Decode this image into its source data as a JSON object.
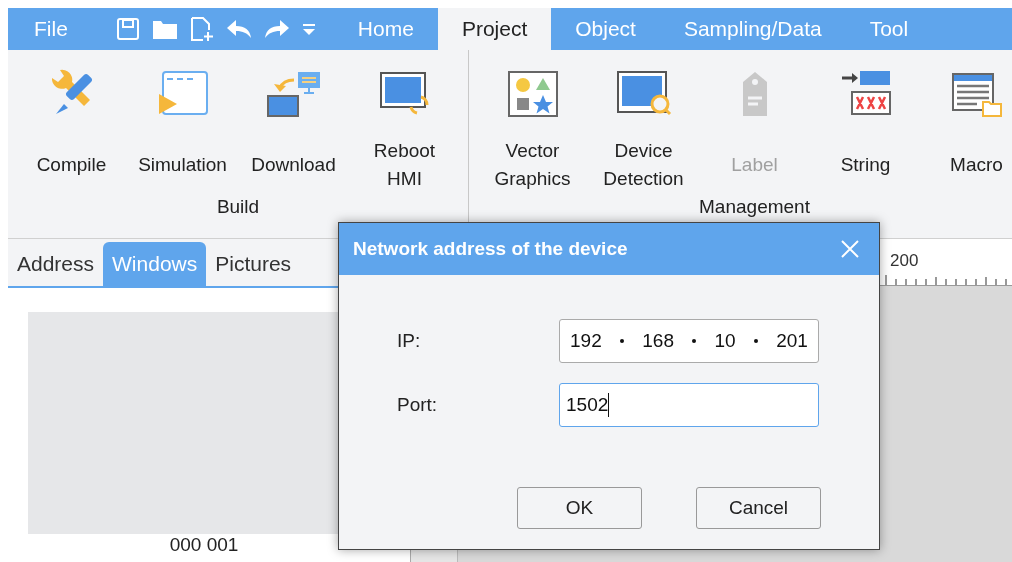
{
  "menu_bar": {
    "file": "File",
    "tabs": [
      {
        "label": "Home",
        "selected": false
      },
      {
        "label": "Project",
        "selected": true
      },
      {
        "label": "Object",
        "selected": false
      },
      {
        "label": "Sampling/Data",
        "selected": false
      },
      {
        "label": "Tool",
        "selected": false
      }
    ]
  },
  "ribbon": {
    "groups": [
      {
        "title": "Build",
        "commands": [
          {
            "label": "Compile",
            "disabled": false
          },
          {
            "label": "Simulation",
            "disabled": false
          },
          {
            "label": "Download",
            "disabled": false
          },
          {
            "label": "Reboot HMI",
            "disabled": false
          }
        ]
      },
      {
        "title": "Management",
        "commands": [
          {
            "label": "Vector Graphics",
            "disabled": false
          },
          {
            "label": "Device Detection",
            "disabled": false
          },
          {
            "label": "Label",
            "disabled": true
          },
          {
            "label": "String",
            "disabled": false
          },
          {
            "label": "Macro",
            "disabled": false
          }
        ]
      }
    ]
  },
  "side_panel": {
    "tabs": [
      {
        "label": "Address",
        "selected": false
      },
      {
        "label": "Windows",
        "selected": true
      },
      {
        "label": "Pictures",
        "selected": false
      }
    ],
    "thumbnail_caption": "000 001"
  },
  "ruler": {
    "label": "200"
  },
  "dialog": {
    "title": "Network address of the device",
    "fields": [
      {
        "label": "IP:",
        "kind": "ip",
        "octets": [
          "192",
          "168",
          "10",
          "201"
        ],
        "focused": false
      },
      {
        "label": "Port:",
        "kind": "text",
        "value": "1502",
        "focused": true
      }
    ],
    "buttons": [
      "OK",
      "Cancel"
    ]
  }
}
